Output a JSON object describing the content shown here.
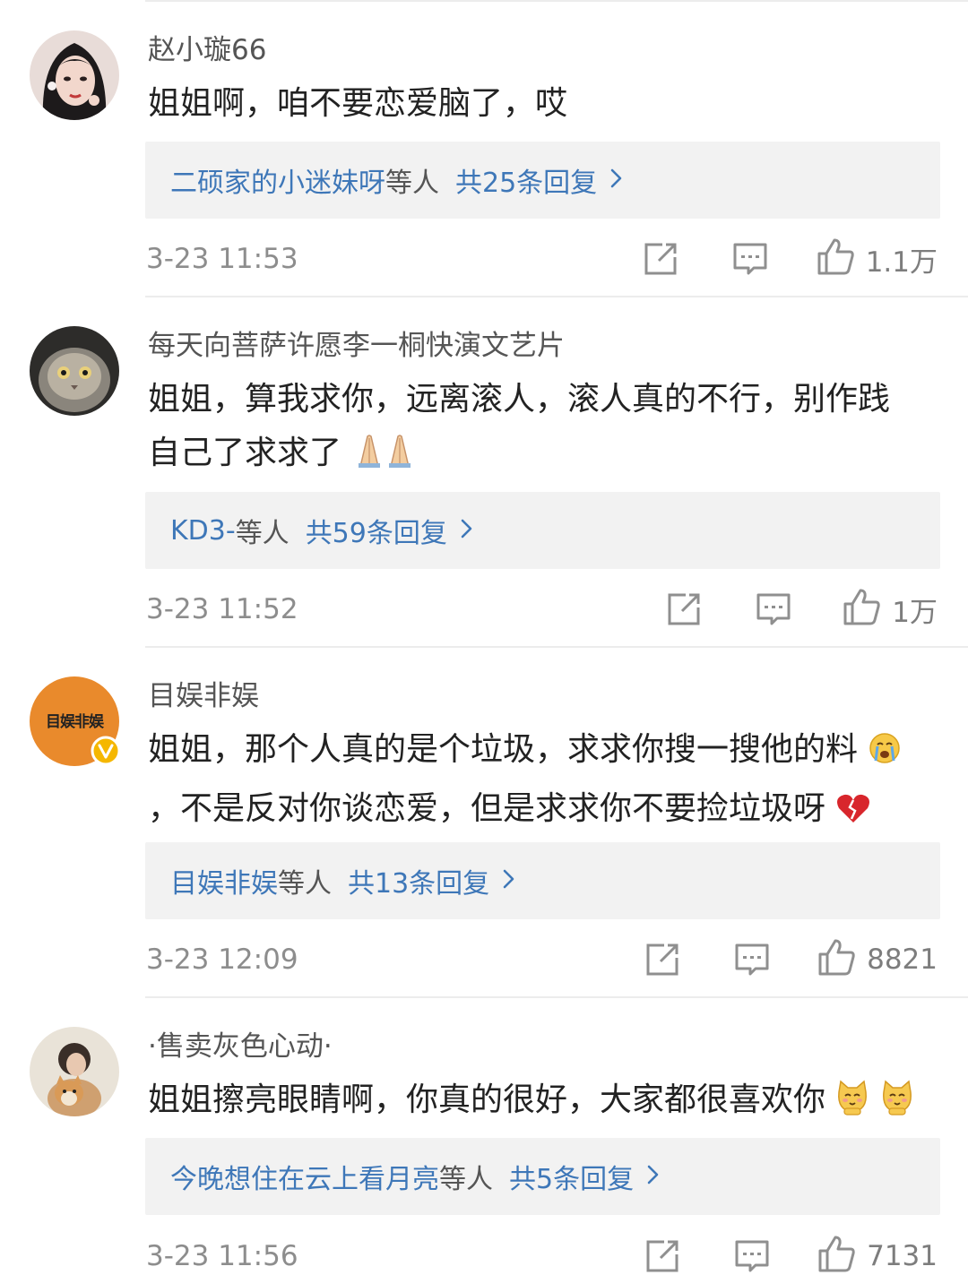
{
  "comments": [
    {
      "username": "赵小璇66",
      "text": "姐姐啊，咱不要恋爱脑了，哎",
      "text_end": "",
      "reply": {
        "names": "二硕家的小迷妹呀",
        "suffix": "等人",
        "count": "共25条回复"
      },
      "time": "3-23 11:53",
      "likes": "1.1万"
    },
    {
      "username": "每天向菩萨许愿李一桐快演文艺片",
      "text": "姐姐，算我求你，远离滚人，滚人真的不行，别作践自己了求求了",
      "text_end": "",
      "reply": {
        "names": "KD3-",
        "suffix": "等人",
        "count": "共59条回复"
      },
      "time": "3-23 11:52",
      "likes": "1万"
    },
    {
      "username": "目娱非娱",
      "avatar_text": "目娱非娱",
      "text": "姐姐，那个人真的是个垃圾，求求你搜一搜他的料",
      "text_end": "，不是反对你谈恋爱，但是求求你不要捡垃圾呀",
      "reply": {
        "names": "目娱非娱",
        "suffix": "等人",
        "count": "共13条回复"
      },
      "time": "3-23 12:09",
      "likes": "8821"
    },
    {
      "username": "·售卖灰色心动·",
      "text": "姐姐擦亮眼睛啊，你真的很好，大家都很喜欢你",
      "text_end": "",
      "reply": {
        "names": "今晚想住在云上看月亮",
        "suffix": "等人",
        "count": "共5条回复"
      },
      "time": "3-23 11:56",
      "likes": "7131"
    }
  ],
  "icons": [
    "share-icon",
    "comment-icon",
    "like-icon",
    "chevron-right-icon",
    "verified-icon",
    "pray-emoji",
    "crying-emoji",
    "broken-heart-emoji",
    "cat-emoji"
  ],
  "colors": {
    "link": "#3e77b8",
    "reply_bg": "#f2f2f2",
    "meta": "#8d8d8d",
    "avatar_badge": "#e98a2c"
  }
}
